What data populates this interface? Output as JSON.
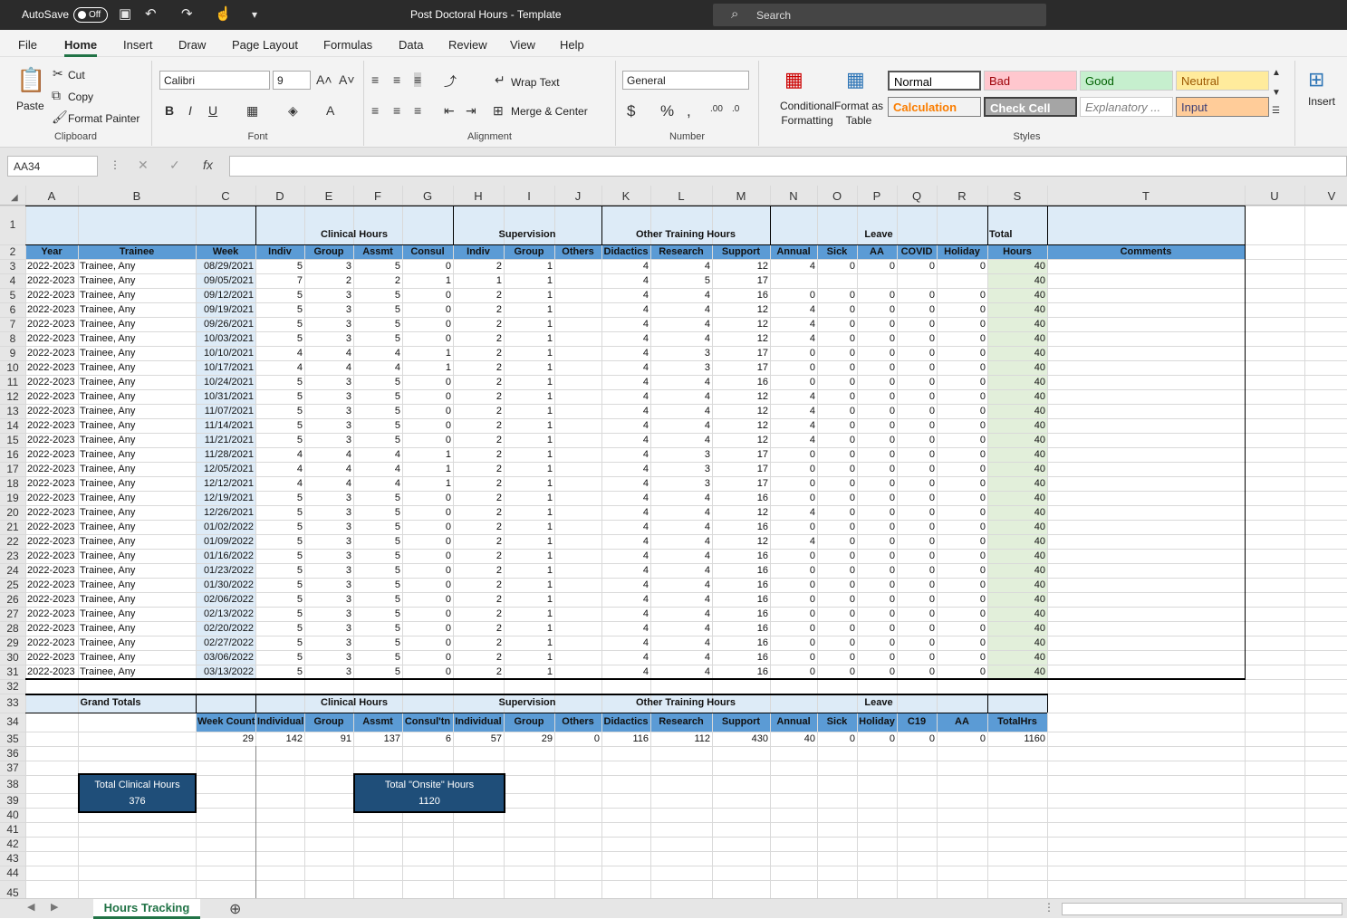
{
  "titlebar": {
    "autosave": "AutoSave",
    "toggle": "Off",
    "title": "Post Doctoral Hours - Template",
    "search": "Search"
  },
  "menu": [
    "File",
    "Home",
    "Insert",
    "Draw",
    "Page Layout",
    "Formulas",
    "Data",
    "Review",
    "View",
    "Help"
  ],
  "ribbon": {
    "clipboard": {
      "paste": "Paste",
      "cut": "Cut",
      "copy": "Copy",
      "painter": "Format Painter",
      "label": "Clipboard"
    },
    "font": {
      "name": "Calibri",
      "size": "9",
      "label": "Font"
    },
    "alignment": {
      "wrap": "Wrap Text",
      "merge": "Merge & Center",
      "label": "Alignment"
    },
    "number": {
      "format": "General",
      "label": "Number"
    },
    "styles": {
      "conditional": "Conditional Formatting",
      "format_table": "Format as Table",
      "normal": "Normal",
      "bad": "Bad",
      "good": "Good",
      "neutral": "Neutral",
      "calculation": "Calculation",
      "check_cell": "Check Cell",
      "explanatory": "Explanatory ...",
      "input": "Input",
      "label": "Styles"
    },
    "cells": {
      "insert": "Insert"
    }
  },
  "namebox": "AA34",
  "columns": [
    "A",
    "B",
    "C",
    "D",
    "E",
    "F",
    "G",
    "H",
    "I",
    "J",
    "K",
    "L",
    "M",
    "N",
    "O",
    "P",
    "Q",
    "R",
    "S",
    "T",
    "U",
    "V"
  ],
  "header1": {
    "clinical": "Clinical Hours",
    "supervision": "Supervision",
    "other": "Other Training Hours",
    "leave": "Leave",
    "total": "Total"
  },
  "header2": [
    "Year",
    "Trainee",
    "Week",
    "Indiv",
    "Group",
    "Assmt",
    "Consul",
    "Indiv",
    "Group",
    "Others",
    "Didactics",
    "Research",
    "Support",
    "Annual",
    "Sick",
    "AA",
    "COVID",
    "Holiday",
    "Hours",
    "Comments"
  ],
  "rows": [
    [
      "2022-2023",
      "Trainee, Any",
      "08/29/2021",
      "5",
      "3",
      "5",
      "0",
      "2",
      "1",
      "",
      "4",
      "4",
      "12",
      "4",
      "0",
      "0",
      "0",
      "0",
      "40"
    ],
    [
      "2022-2023",
      "Trainee, Any",
      "09/05/2021",
      "7",
      "2",
      "2",
      "1",
      "1",
      "1",
      "",
      "4",
      "5",
      "17",
      "",
      "",
      "",
      "",
      "",
      "40"
    ],
    [
      "2022-2023",
      "Trainee, Any",
      "09/12/2021",
      "5",
      "3",
      "5",
      "0",
      "2",
      "1",
      "",
      "4",
      "4",
      "16",
      "0",
      "0",
      "0",
      "0",
      "0",
      "40"
    ],
    [
      "2022-2023",
      "Trainee, Any",
      "09/19/2021",
      "5",
      "3",
      "5",
      "0",
      "2",
      "1",
      "",
      "4",
      "4",
      "12",
      "4",
      "0",
      "0",
      "0",
      "0",
      "40"
    ],
    [
      "2022-2023",
      "Trainee, Any",
      "09/26/2021",
      "5",
      "3",
      "5",
      "0",
      "2",
      "1",
      "",
      "4",
      "4",
      "12",
      "4",
      "0",
      "0",
      "0",
      "0",
      "40"
    ],
    [
      "2022-2023",
      "Trainee, Any",
      "10/03/2021",
      "5",
      "3",
      "5",
      "0",
      "2",
      "1",
      "",
      "4",
      "4",
      "12",
      "4",
      "0",
      "0",
      "0",
      "0",
      "40"
    ],
    [
      "2022-2023",
      "Trainee, Any",
      "10/10/2021",
      "4",
      "4",
      "4",
      "1",
      "2",
      "1",
      "",
      "4",
      "3",
      "17",
      "0",
      "0",
      "0",
      "0",
      "0",
      "40"
    ],
    [
      "2022-2023",
      "Trainee, Any",
      "10/17/2021",
      "4",
      "4",
      "4",
      "1",
      "2",
      "1",
      "",
      "4",
      "3",
      "17",
      "0",
      "0",
      "0",
      "0",
      "0",
      "40"
    ],
    [
      "2022-2023",
      "Trainee, Any",
      "10/24/2021",
      "5",
      "3",
      "5",
      "0",
      "2",
      "1",
      "",
      "4",
      "4",
      "16",
      "0",
      "0",
      "0",
      "0",
      "0",
      "40"
    ],
    [
      "2022-2023",
      "Trainee, Any",
      "10/31/2021",
      "5",
      "3",
      "5",
      "0",
      "2",
      "1",
      "",
      "4",
      "4",
      "12",
      "4",
      "0",
      "0",
      "0",
      "0",
      "40"
    ],
    [
      "2022-2023",
      "Trainee, Any",
      "11/07/2021",
      "5",
      "3",
      "5",
      "0",
      "2",
      "1",
      "",
      "4",
      "4",
      "12",
      "4",
      "0",
      "0",
      "0",
      "0",
      "40"
    ],
    [
      "2022-2023",
      "Trainee, Any",
      "11/14/2021",
      "5",
      "3",
      "5",
      "0",
      "2",
      "1",
      "",
      "4",
      "4",
      "12",
      "4",
      "0",
      "0",
      "0",
      "0",
      "40"
    ],
    [
      "2022-2023",
      "Trainee, Any",
      "11/21/2021",
      "5",
      "3",
      "5",
      "0",
      "2",
      "1",
      "",
      "4",
      "4",
      "12",
      "4",
      "0",
      "0",
      "0",
      "0",
      "40"
    ],
    [
      "2022-2023",
      "Trainee, Any",
      "11/28/2021",
      "4",
      "4",
      "4",
      "1",
      "2",
      "1",
      "",
      "4",
      "3",
      "17",
      "0",
      "0",
      "0",
      "0",
      "0",
      "40"
    ],
    [
      "2022-2023",
      "Trainee, Any",
      "12/05/2021",
      "4",
      "4",
      "4",
      "1",
      "2",
      "1",
      "",
      "4",
      "3",
      "17",
      "0",
      "0",
      "0",
      "0",
      "0",
      "40"
    ],
    [
      "2022-2023",
      "Trainee, Any",
      "12/12/2021",
      "4",
      "4",
      "4",
      "1",
      "2",
      "1",
      "",
      "4",
      "3",
      "17",
      "0",
      "0",
      "0",
      "0",
      "0",
      "40"
    ],
    [
      "2022-2023",
      "Trainee, Any",
      "12/19/2021",
      "5",
      "3",
      "5",
      "0",
      "2",
      "1",
      "",
      "4",
      "4",
      "16",
      "0",
      "0",
      "0",
      "0",
      "0",
      "40"
    ],
    [
      "2022-2023",
      "Trainee, Any",
      "12/26/2021",
      "5",
      "3",
      "5",
      "0",
      "2",
      "1",
      "",
      "4",
      "4",
      "12",
      "4",
      "0",
      "0",
      "0",
      "0",
      "40"
    ],
    [
      "2022-2023",
      "Trainee, Any",
      "01/02/2022",
      "5",
      "3",
      "5",
      "0",
      "2",
      "1",
      "",
      "4",
      "4",
      "16",
      "0",
      "0",
      "0",
      "0",
      "0",
      "40"
    ],
    [
      "2022-2023",
      "Trainee, Any",
      "01/09/2022",
      "5",
      "3",
      "5",
      "0",
      "2",
      "1",
      "",
      "4",
      "4",
      "12",
      "4",
      "0",
      "0",
      "0",
      "0",
      "40"
    ],
    [
      "2022-2023",
      "Trainee, Any",
      "01/16/2022",
      "5",
      "3",
      "5",
      "0",
      "2",
      "1",
      "",
      "4",
      "4",
      "16",
      "0",
      "0",
      "0",
      "0",
      "0",
      "40"
    ],
    [
      "2022-2023",
      "Trainee, Any",
      "01/23/2022",
      "5",
      "3",
      "5",
      "0",
      "2",
      "1",
      "",
      "4",
      "4",
      "16",
      "0",
      "0",
      "0",
      "0",
      "0",
      "40"
    ],
    [
      "2022-2023",
      "Trainee, Any",
      "01/30/2022",
      "5",
      "3",
      "5",
      "0",
      "2",
      "1",
      "",
      "4",
      "4",
      "16",
      "0",
      "0",
      "0",
      "0",
      "0",
      "40"
    ],
    [
      "2022-2023",
      "Trainee, Any",
      "02/06/2022",
      "5",
      "3",
      "5",
      "0",
      "2",
      "1",
      "",
      "4",
      "4",
      "16",
      "0",
      "0",
      "0",
      "0",
      "0",
      "40"
    ],
    [
      "2022-2023",
      "Trainee, Any",
      "02/13/2022",
      "5",
      "3",
      "5",
      "0",
      "2",
      "1",
      "",
      "4",
      "4",
      "16",
      "0",
      "0",
      "0",
      "0",
      "0",
      "40"
    ],
    [
      "2022-2023",
      "Trainee, Any",
      "02/20/2022",
      "5",
      "3",
      "5",
      "0",
      "2",
      "1",
      "",
      "4",
      "4",
      "16",
      "0",
      "0",
      "0",
      "0",
      "0",
      "40"
    ],
    [
      "2022-2023",
      "Trainee, Any",
      "02/27/2022",
      "5",
      "3",
      "5",
      "0",
      "2",
      "1",
      "",
      "4",
      "4",
      "16",
      "0",
      "0",
      "0",
      "0",
      "0",
      "40"
    ],
    [
      "2022-2023",
      "Trainee, Any",
      "03/06/2022",
      "5",
      "3",
      "5",
      "0",
      "2",
      "1",
      "",
      "4",
      "4",
      "16",
      "0",
      "0",
      "0",
      "0",
      "0",
      "40"
    ],
    [
      "2022-2023",
      "Trainee, Any",
      "03/13/2022",
      "5",
      "3",
      "5",
      "0",
      "2",
      "1",
      "",
      "4",
      "4",
      "16",
      "0",
      "0",
      "0",
      "0",
      "0",
      "40"
    ]
  ],
  "totals": {
    "grand_totals": "Grand Totals",
    "groups": {
      "clinical": "Clinical Hours",
      "supervision": "Supervision",
      "other": "Other Training Hours",
      "leave": "Leave"
    },
    "headers": [
      "Week Count",
      "Individual",
      "Group",
      "Assmt",
      "Consul'tn",
      "Individual",
      "Group",
      "Others",
      "Didactics",
      "Research",
      "Support",
      "Annual",
      "Sick",
      "Holiday",
      "C19",
      "AA",
      "TotalHrs"
    ],
    "values": [
      "29",
      "142",
      "91",
      "137",
      "6",
      "57",
      "29",
      "0",
      "116",
      "112",
      "430",
      "40",
      "0",
      "0",
      "0",
      "0",
      "1160"
    ]
  },
  "boxes": {
    "clinical_label": "Total Clinical Hours",
    "clinical_value": "376",
    "onsite_label": "Total \"Onsite\" Hours",
    "onsite_value": "1120"
  },
  "sheet_tab": "Hours Tracking"
}
